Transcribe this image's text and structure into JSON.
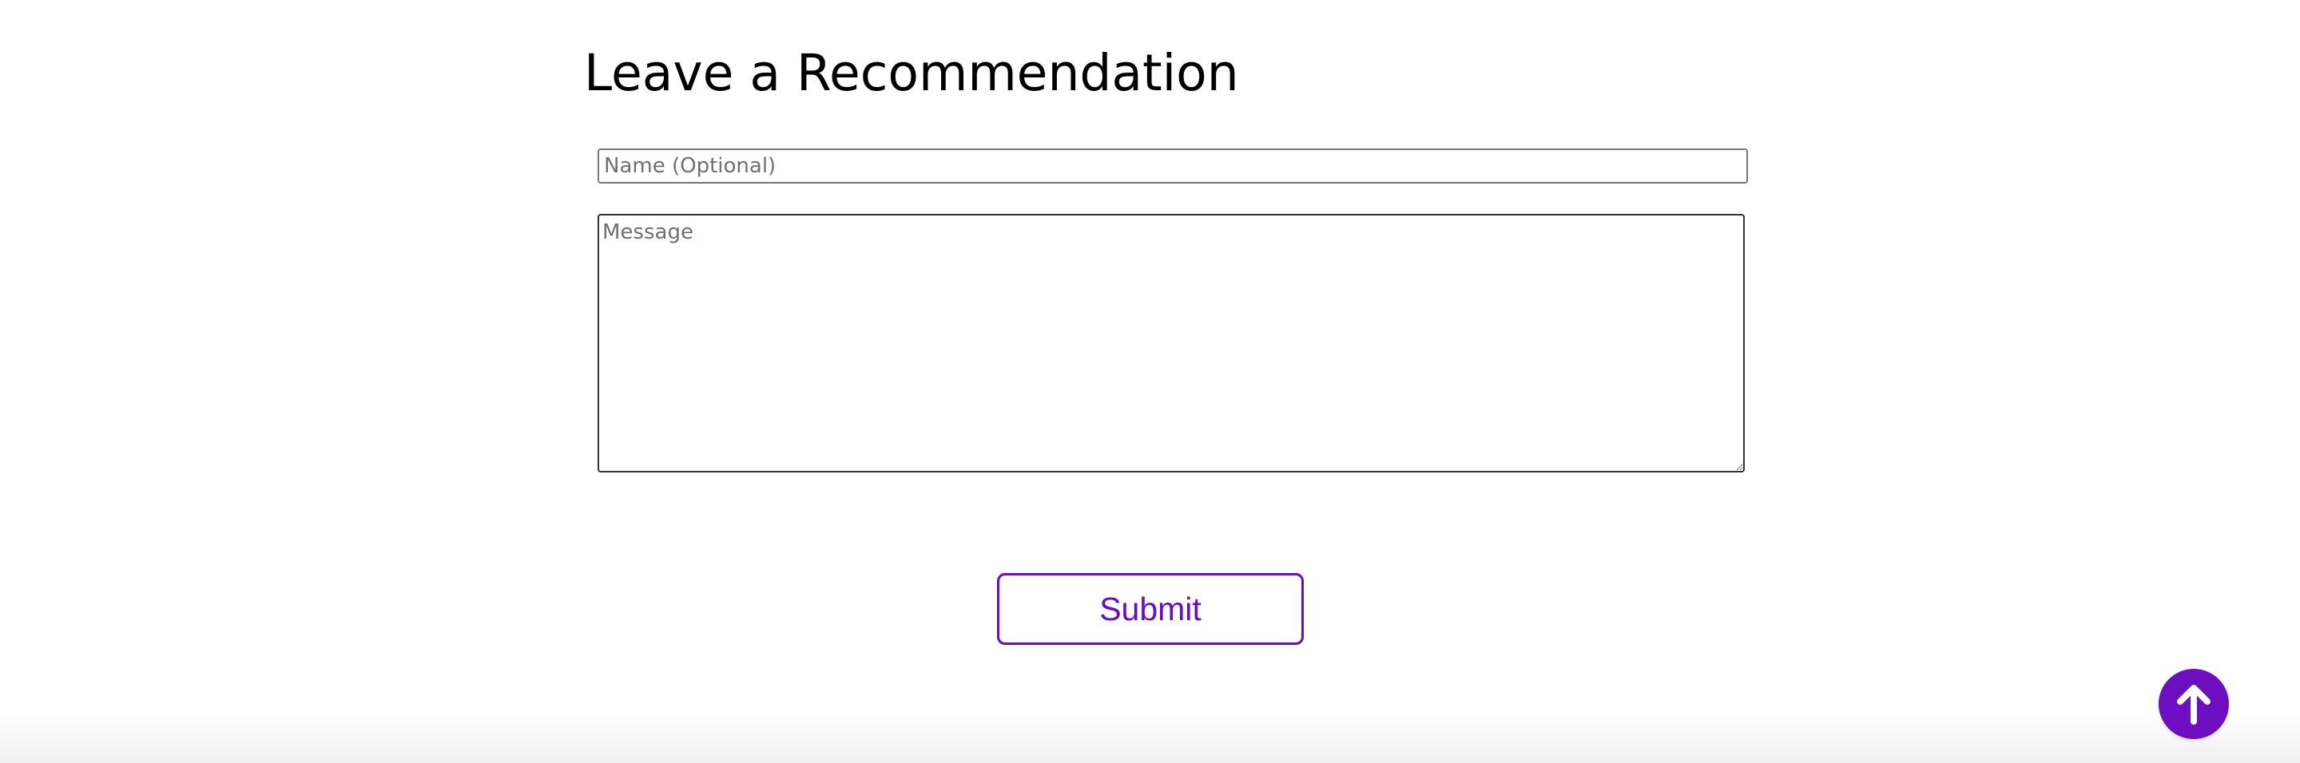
{
  "recommendation_form": {
    "title": "Leave a Recommendation",
    "name_placeholder": "Name (Optional)",
    "name_value": "",
    "message_placeholder": "Message",
    "message_value": "",
    "submit_label": "Submit"
  },
  "scroll_to_top": {
    "icon": "arrow-up-icon"
  },
  "colors": {
    "accent": "#6b0ac7",
    "background": "#ffffff",
    "title_text": "#000000"
  }
}
